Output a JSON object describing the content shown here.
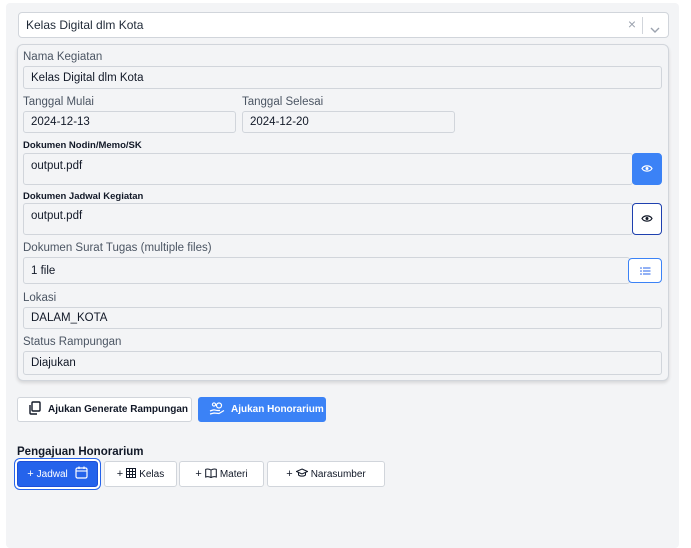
{
  "event_select": {
    "value": "Kelas Digital dlm Kota",
    "clear_symbol": "×"
  },
  "form": {
    "nama_kegiatan": {
      "label": "Nama Kegiatan",
      "value": "Kelas Digital dlm Kota"
    },
    "tanggal_mulai": {
      "label": "Tanggal Mulai",
      "value": "2024-12-13"
    },
    "tanggal_selesai": {
      "label": "Tanggal Selesai",
      "value": "2024-12-20"
    },
    "dokumen_nodin": {
      "label": "Dokumen Nodin/Memo/SK",
      "value": "output.pdf"
    },
    "dokumen_jadwal": {
      "label": "Dokumen Jadwal Kegiatan",
      "value": "output.pdf"
    },
    "dokumen_surat_tugas": {
      "label": "Dokumen Surat Tugas (multiple files)",
      "value": "1 file"
    },
    "lokasi": {
      "label": "Lokasi",
      "value": "DALAM_KOTA"
    },
    "status_rampungan": {
      "label": "Status Rampungan",
      "value": "Diajukan"
    }
  },
  "actions": {
    "generate_rampungan": "Ajukan Generate Rampungan",
    "ajukan_honorarium": "Ajukan Honorarium"
  },
  "honorarium": {
    "title": "Pengajuan Honorarium",
    "tabs": [
      {
        "plus": "+",
        "label": "Jadwal",
        "icon": "calendar-icon"
      },
      {
        "plus": "+",
        "label": "Kelas",
        "icon": "table-icon"
      },
      {
        "plus": "+",
        "label": "Materi",
        "icon": "book-icon"
      },
      {
        "plus": "+",
        "label": "Narasumber",
        "icon": "graduation-cap-icon"
      }
    ]
  },
  "colors": {
    "primary": "#3b82f6",
    "primary_dark": "#2563eb",
    "panel_bg": "#f3f4f6",
    "border": "#d1d5db"
  }
}
